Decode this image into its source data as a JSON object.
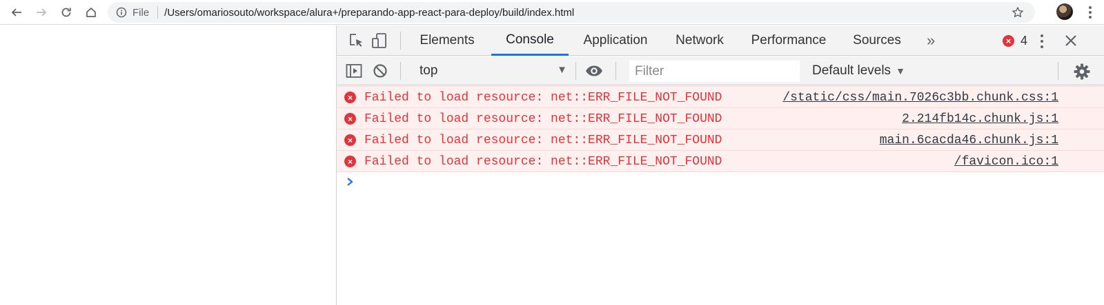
{
  "browser": {
    "scheme_label": "File",
    "url": "/Users/omariosouto/workspace/alura+/preparando-app-react-para-deploy/build/index.html"
  },
  "devtools": {
    "tabs": [
      {
        "label": "Elements"
      },
      {
        "label": "Console"
      },
      {
        "label": "Application"
      },
      {
        "label": "Network"
      },
      {
        "label": "Performance"
      },
      {
        "label": "Sources"
      }
    ],
    "active_tab": "Console",
    "more_tabs_label": "»",
    "error_count": "4",
    "error_badge_icon": "×",
    "console": {
      "context": "top",
      "filter_placeholder": "Filter",
      "levels": "Default levels",
      "dropdown_arrow": "▼",
      "messages": [
        {
          "text": "Failed to load resource: net::ERR_FILE_NOT_FOUND",
          "source": "/static/css/main.7026c3bb.chunk.css:1"
        },
        {
          "text": "Failed to load resource: net::ERR_FILE_NOT_FOUND",
          "source": "2.214fb14c.chunk.js:1"
        },
        {
          "text": "Failed to load resource: net::ERR_FILE_NOT_FOUND",
          "source": "main.6cacda46.chunk.js:1"
        },
        {
          "text": "Failed to load resource: net::ERR_FILE_NOT_FOUND",
          "source": "/favicon.ico:1"
        }
      ]
    }
  },
  "colors": {
    "error_red": "#e0353b",
    "error_bg": "#fff0f0",
    "active_tab_blue": "#1a73e8",
    "prompt_blue": "#1a73e8"
  },
  "icons": {
    "back": "back-arrow-icon",
    "forward": "forward-arrow-icon",
    "reload": "reload-icon",
    "home": "home-icon",
    "info": "info-icon",
    "star": "bookmark-star-icon",
    "inspect": "inspect-element-icon",
    "device": "device-toolbar-icon",
    "sidebar": "console-sidebar-icon",
    "clear": "clear-console-icon",
    "eye": "live-expression-icon",
    "gear": "settings-gear-icon",
    "error": "error-icon",
    "prompt": "prompt-chevron-icon"
  }
}
